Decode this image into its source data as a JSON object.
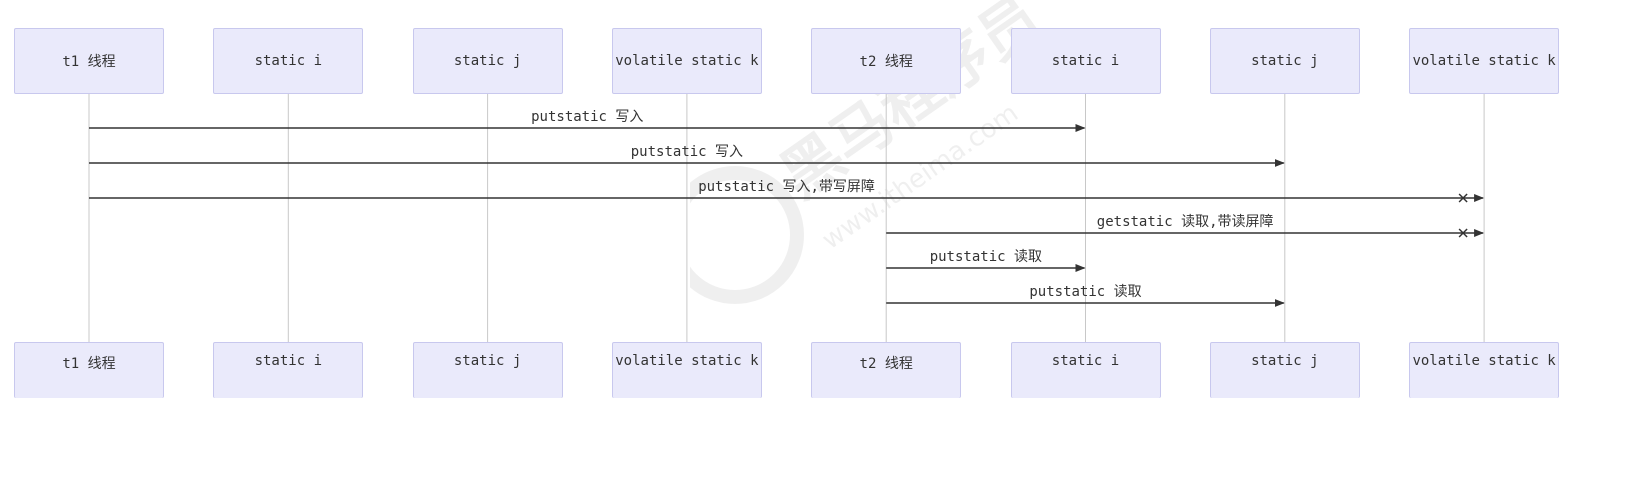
{
  "actors": [
    {
      "label": "t1 线程"
    },
    {
      "label": "static i"
    },
    {
      "label": "static j"
    },
    {
      "label": "volatile static k"
    },
    {
      "label": "t2 线程"
    },
    {
      "label": "static i"
    },
    {
      "label": "static j"
    },
    {
      "label": "volatile static k"
    }
  ],
  "messages": [
    {
      "from": 0,
      "to": 5,
      "label": "putstatic 写入",
      "cross": false
    },
    {
      "from": 0,
      "to": 6,
      "label": "putstatic 写入",
      "cross": false
    },
    {
      "from": 0,
      "to": 7,
      "label": "putstatic 写入,带写屏障",
      "cross": true
    },
    {
      "from": 4,
      "to": 7,
      "label": "getstatic 读取,带读屏障",
      "cross": true
    },
    {
      "from": 4,
      "to": 5,
      "label": "putstatic 读取",
      "cross": false
    },
    {
      "from": 4,
      "to": 6,
      "label": "putstatic 读取",
      "cross": false
    }
  ],
  "watermark": {
    "text": "黑马程序员",
    "url": "www.itheima.com"
  },
  "colors": {
    "actor_fill": "#eaeafb",
    "actor_border": "#c8c8ee",
    "lifeline": "#c8c8c8",
    "message_line": "#333333"
  }
}
